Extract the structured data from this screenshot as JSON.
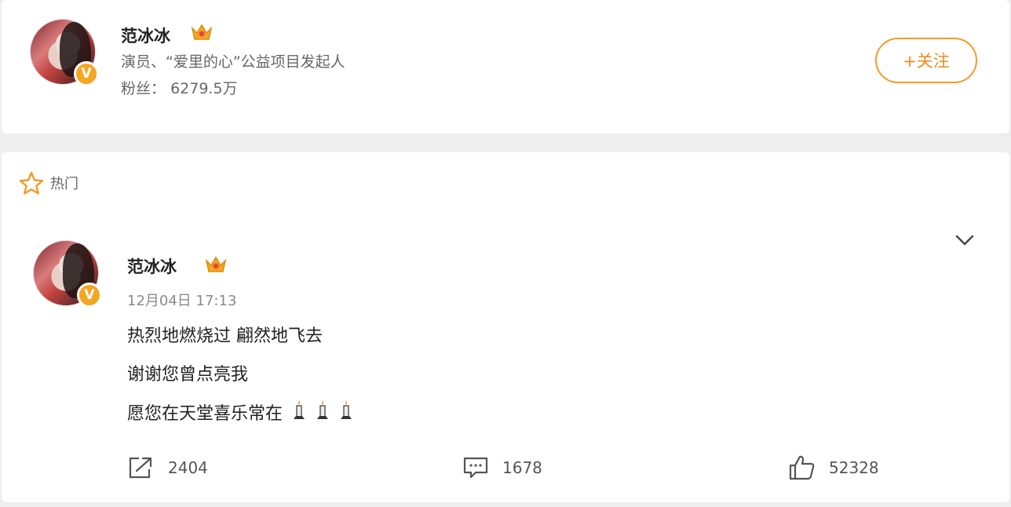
{
  "profile": {
    "name": "范冰冰",
    "description": "演员、“爱里的心”公益项目发起人",
    "fans_label": "粉丝：",
    "fans_value": "6279.5万",
    "verified_mark": "V",
    "follow_label": "+关注"
  },
  "hot_section": {
    "label": "热门"
  },
  "post": {
    "author": "范冰冰",
    "verified_mark": "V",
    "time": "12月04日 17:13",
    "lines": [
      "热烈地燃烧过 翩然地飞去",
      "谢谢您曾点亮我",
      "愿您在天堂喜乐常在"
    ],
    "actions": {
      "repost_count": "2404",
      "comment_count": "1678",
      "like_count": "52328"
    }
  },
  "colors": {
    "accent_orange": "#f39a2a",
    "badge_gold": "#f5a623",
    "text_primary": "#222222",
    "text_secondary": "#666666"
  },
  "icons": {
    "crown": "crown-badge-icon",
    "star": "star-outline-icon",
    "chevron": "chevron-down-icon",
    "repost": "share-arrow-icon",
    "comment": "comment-bubble-icon",
    "like": "thumbs-up-icon",
    "candle": "candle-icon"
  }
}
